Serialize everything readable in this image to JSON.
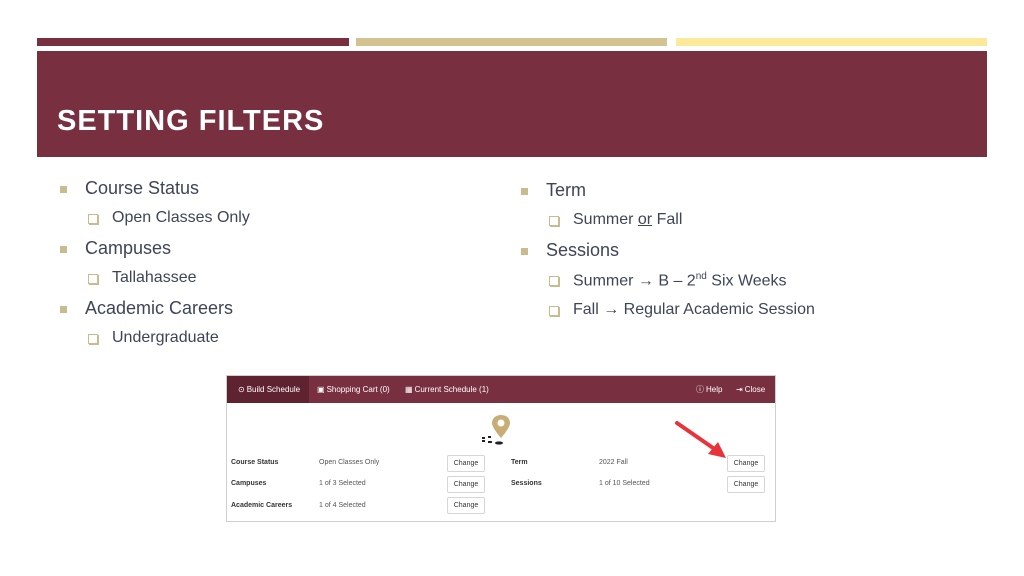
{
  "slide": {
    "title": "SETTING FILTERS",
    "colors": {
      "garnet": "#782f40",
      "gold": "#d4c291",
      "light_gold": "#fde99a"
    },
    "left_list": [
      {
        "level": 1,
        "text": "Course Status"
      },
      {
        "level": 2,
        "text": "Open Classes Only"
      },
      {
        "level": 1,
        "text": "Campuses"
      },
      {
        "level": 2,
        "text": "Tallahassee"
      },
      {
        "level": 1,
        "text": "Academic Careers"
      },
      {
        "level": 2,
        "text": "Undergraduate"
      }
    ],
    "right_list": {
      "term": "Term",
      "term_sub_a": "Summer ",
      "term_sub_or": "or",
      "term_sub_b": " Fall",
      "sessions": "Sessions",
      "session_summer_a": "Summer → B – 2",
      "session_summer_sup": "nd",
      "session_summer_b": " Six Weeks",
      "session_fall": "Fall → Regular Academic Session"
    }
  },
  "screenshot": {
    "nav": {
      "build_schedule": "Build Schedule",
      "shopping_cart": "Shopping Cart (0)",
      "current_schedule": "Current Schedule (1)",
      "help": "Help",
      "close": "Close",
      "icons": {
        "build": "⊙",
        "cart": "🛒",
        "calendar": "▦",
        "help": "?",
        "close": "⇥"
      }
    },
    "filters_left": [
      {
        "label": "Course Status",
        "value": "Open Classes Only",
        "button": "Change"
      },
      {
        "label": "Campuses",
        "value": "1 of 3 Selected",
        "button": "Change"
      },
      {
        "label": "Academic Careers",
        "value": "1 of 4 Selected",
        "button": "Change"
      }
    ],
    "filters_right": [
      {
        "label": "Term",
        "value": "2022 Fall",
        "button": "Change"
      },
      {
        "label": "Sessions",
        "value": "1 of 10 Selected",
        "button": "Change"
      }
    ]
  }
}
